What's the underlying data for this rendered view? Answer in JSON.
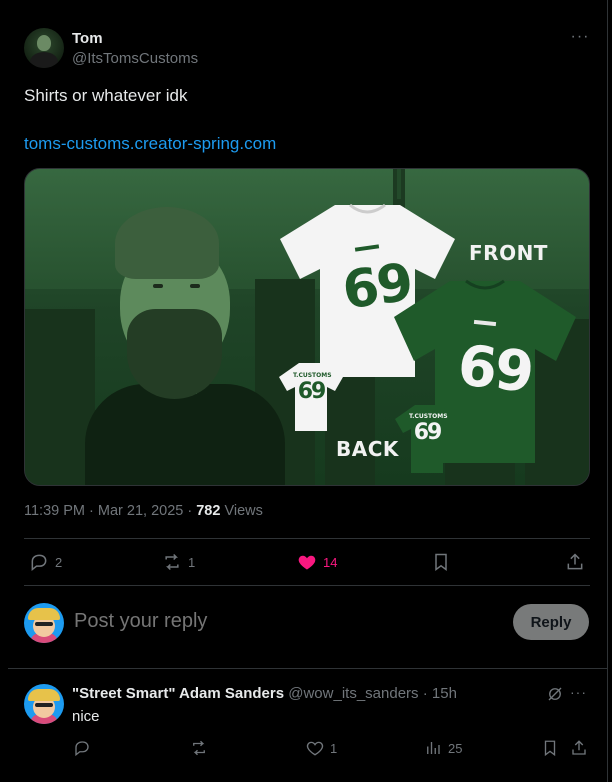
{
  "tweet": {
    "author_name": "Tom",
    "author_handle": "@ItsTomsCustoms",
    "more_glyph": "···",
    "text": "Shirts or whatever idk",
    "link": "toms-customs.creator-spring.com",
    "media": {
      "front_label": "FRONT",
      "back_label": "BACK",
      "shirt_number": "69",
      "brand": "T.CUSTOMS",
      "palette": {
        "green": "#1f5a2a",
        "white": "#f4f4f4"
      }
    },
    "time": "11:39 PM",
    "date": "Mar 21, 2025",
    "views_count": "782",
    "views_label": "Views",
    "stats": {
      "replies": "2",
      "reposts": "1",
      "likes": "14"
    }
  },
  "reply_box": {
    "placeholder": "Post your reply",
    "button_label": "Reply"
  },
  "comment": {
    "name": "\"Street Smart\" Adam Sanders",
    "handle": "@wow_its_sanders",
    "age": "15h",
    "text": "nice",
    "likes": "1",
    "views": "25"
  },
  "colors": {
    "background": "#000000",
    "text": "#e7e9ea",
    "secondary": "#71767b",
    "link": "#1d9bf0",
    "like": "#f91880",
    "border": "#2f3336"
  }
}
